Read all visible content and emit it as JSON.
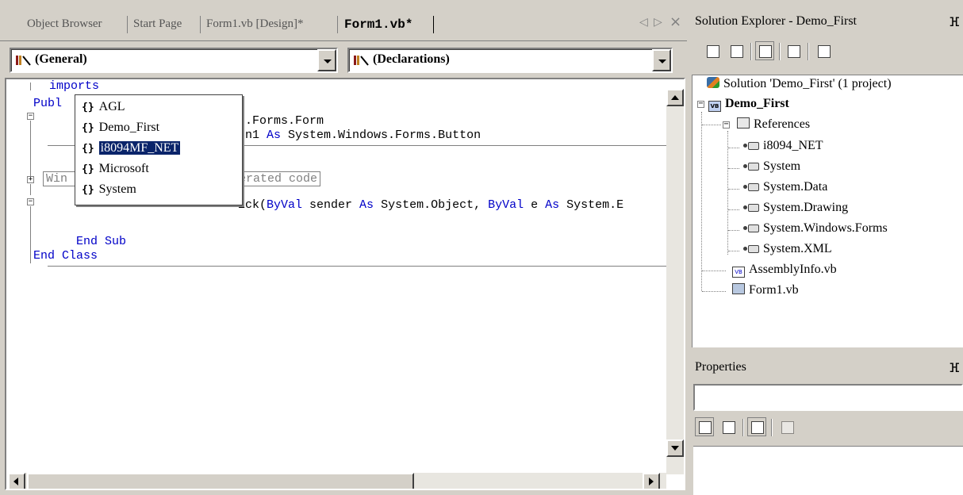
{
  "editor": {
    "tabs": [
      {
        "label": "Object Browser",
        "active": false
      },
      {
        "label": "Start Page",
        "active": false
      },
      {
        "label": "Form1.vb [Design]*",
        "active": false
      },
      {
        "label": "Form1.vb*",
        "active": true
      }
    ],
    "nav_prev": "◁",
    "nav_next": "▷",
    "nav_close": "×",
    "class_combo": "(General)",
    "method_combo": "(Declarations)",
    "code": {
      "line1": "imports",
      "line2_prefix": "Publ",
      "line3_tail": "s.Forms.Form",
      "line4_tail_a": "on1 ",
      "line4_kw": "As",
      "line4_tail_b": " System.Windows.Forms.Button",
      "region_a": "Win",
      "region_b": "erated code",
      "line6_tail_a": "ick(",
      "line6_kw1": "ByVal",
      "line6_mid1": " sender ",
      "line6_kw2": "As",
      "line6_mid2": " System.Object, ",
      "line6_kw3": "ByVal",
      "line6_mid3": " e ",
      "line6_kw4": "As",
      "line6_mid4": " System.E",
      "end_sub": "End Sub",
      "end_class": "End Class"
    },
    "intellisense": [
      {
        "label": "AGL",
        "selected": false
      },
      {
        "label": "Demo_First",
        "selected": false
      },
      {
        "label": "i8094MF_NET",
        "selected": true
      },
      {
        "label": "Microsoft",
        "selected": false
      },
      {
        "label": "System",
        "selected": false
      }
    ],
    "intellisense_braces": "{}"
  },
  "solution_explorer": {
    "title": "Solution Explorer - Demo_First",
    "pin": "ⴼ",
    "solution": "Solution 'Demo_First' (1 project)",
    "project": "Demo_First",
    "references_label": "References",
    "references": [
      "i8094_NET",
      "System",
      "System.Data",
      "System.Drawing",
      "System.Windows.Forms",
      "System.XML"
    ],
    "files": [
      "AssemblyInfo.vb",
      "Form1.vb"
    ],
    "expand_minus": "−"
  },
  "properties": {
    "title": "Properties",
    "pin": "ⴼ"
  },
  "colors": {
    "chrome": "#d4d0c8",
    "selection": "#0a246a",
    "keyword": "#0000c8"
  }
}
